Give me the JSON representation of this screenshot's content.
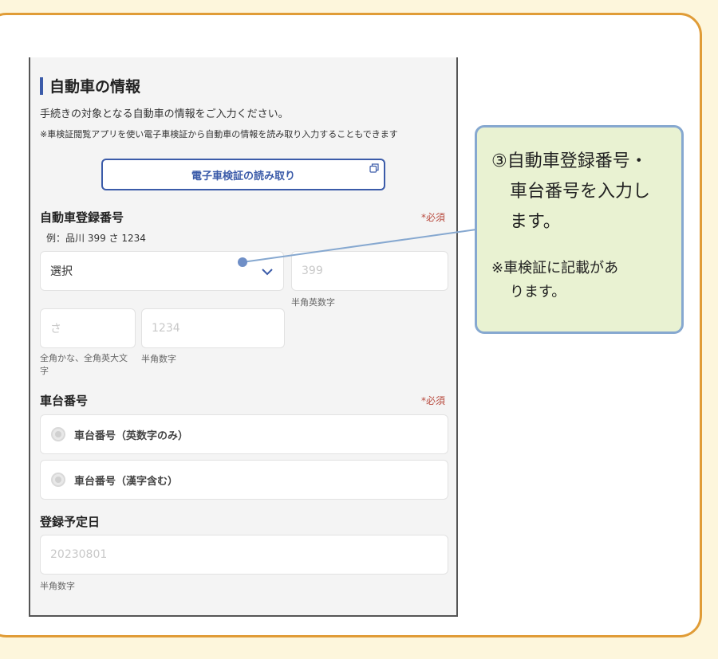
{
  "form": {
    "section_title": "自動車の情報",
    "intro_text": "手続きの対象となる自動車の情報をご入力ください。",
    "note_text": "※車検証閲覧アプリを使い電子車検証から自動車の情報を読み取り入力することもできます",
    "read_button_label": "電子車検証の読み取り",
    "registration": {
      "label": "自動車登録番号",
      "required_mark": "*必須",
      "example": "例：品川 399 さ 1234",
      "region_select_value": "選択",
      "class_placeholder": "399",
      "class_hint": "半角英数字",
      "kana_placeholder": "さ",
      "kana_hint_line1": "全角かな、全角英大文",
      "kana_hint_line2": "字",
      "number_placeholder": "1234",
      "number_hint": "半角数字"
    },
    "chassis": {
      "label": "車台番号",
      "required_mark": "*必須",
      "option1": "車台番号（英数字のみ）",
      "option2": "車台番号（漢字含む）"
    },
    "date": {
      "label": "登録予定日",
      "placeholder": "20230801",
      "hint": "半角数字"
    }
  },
  "callout": {
    "main_line1": "③自動車登録番号・",
    "main_line2": "車台番号を入力し",
    "main_line3": "ます。",
    "note_line1": "※車検証に記載があ",
    "note_line2": "ります。"
  },
  "colors": {
    "accent_blue": "#3b5ba9",
    "frame_orange": "#e09c37",
    "callout_fill": "#e9f2d2",
    "callout_border": "#86a8d0",
    "required_red": "#b84a3e"
  }
}
